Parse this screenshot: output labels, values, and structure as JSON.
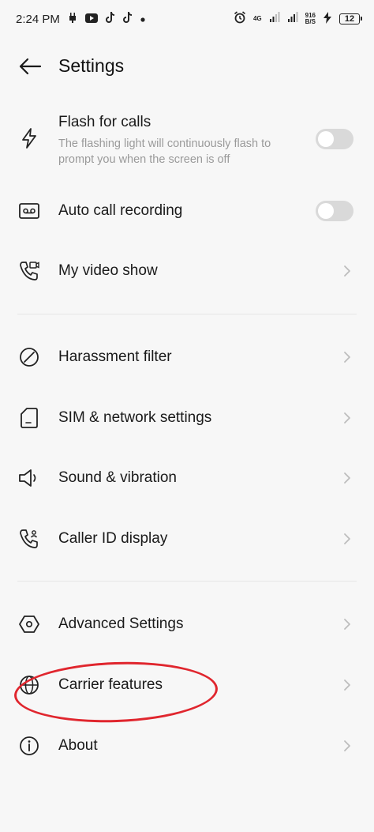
{
  "status_bar": {
    "time": "2:24 PM",
    "network_type": "4G",
    "speed_value": "916",
    "speed_unit": "B/S",
    "battery": "12",
    "icons": [
      "usb-debug-icon",
      "youtube-icon",
      "tiktok-icon",
      "tiktok-icon",
      "dot-icon",
      "alarm-icon",
      "signal-icon",
      "signal-icon",
      "charging-icon",
      "battery-icon"
    ]
  },
  "header": {
    "title": "Settings"
  },
  "items": [
    {
      "label": "Flash for calls",
      "sub": "The flashing light will continuously flash to prompt you when the screen is off",
      "icon": "flash-icon",
      "control": "toggle",
      "on": false
    },
    {
      "label": "Auto call recording",
      "icon": "voicemail-icon",
      "control": "toggle",
      "on": false
    },
    {
      "label": "My video show",
      "icon": "video-call-icon",
      "control": "chevron"
    },
    {
      "label": "Harassment filter",
      "icon": "block-icon",
      "control": "chevron"
    },
    {
      "label": "SIM & network settings",
      "icon": "sim-card-icon",
      "control": "chevron"
    },
    {
      "label": "Sound & vibration",
      "icon": "speaker-icon",
      "control": "chevron"
    },
    {
      "label": "Caller ID display",
      "icon": "caller-id-icon",
      "control": "chevron"
    },
    {
      "label": "Advanced Settings",
      "icon": "hexagon-settings-icon",
      "control": "chevron"
    },
    {
      "label": "Carrier features",
      "icon": "globe-icon",
      "control": "chevron"
    },
    {
      "label": "About",
      "icon": "info-icon",
      "control": "chevron"
    }
  ],
  "colors": {
    "annotation": "#e0262e",
    "toggle_off": "#d9d9d9",
    "secondary_text": "#9a9a9a"
  }
}
